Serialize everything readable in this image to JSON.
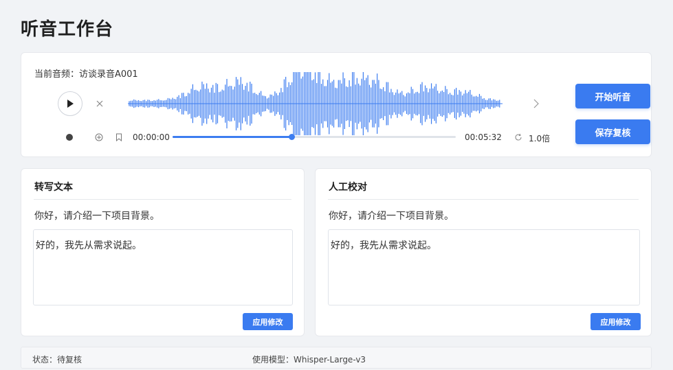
{
  "page": {
    "title": "听音工作台"
  },
  "player": {
    "current_audio": "当前音频：访谈录音A001",
    "elapsed": "00:00:00",
    "duration": "00:05:32",
    "speed": "1.0倍",
    "progress_fraction": 0.42,
    "icons": {
      "play": "play-icon",
      "close": "close-icon",
      "next": "chevron-right-icon",
      "record": "record-dot-icon",
      "add": "plus-circle-icon",
      "bookmark": "bookmark-icon",
      "speed": "refresh-icon"
    },
    "accent_color": "#3a7bf0"
  },
  "actions": {
    "start_listen": "开始听音",
    "save_review": "保存复核"
  },
  "panels": {
    "transcript": {
      "title": "转写文本",
      "line1": "你好，请介绍一下项目背景。",
      "textbox": "好的，我先从需求说起。",
      "apply_label": "应用修改"
    },
    "manual": {
      "title": "人工校对",
      "line1": "你好，请介绍一下项目背景。",
      "textbox": "好的，我先从需求说起。",
      "apply_label": "应用修改"
    }
  },
  "status": {
    "state": "状态：待复核",
    "model": "使用模型：Whisper-Large-v3"
  }
}
